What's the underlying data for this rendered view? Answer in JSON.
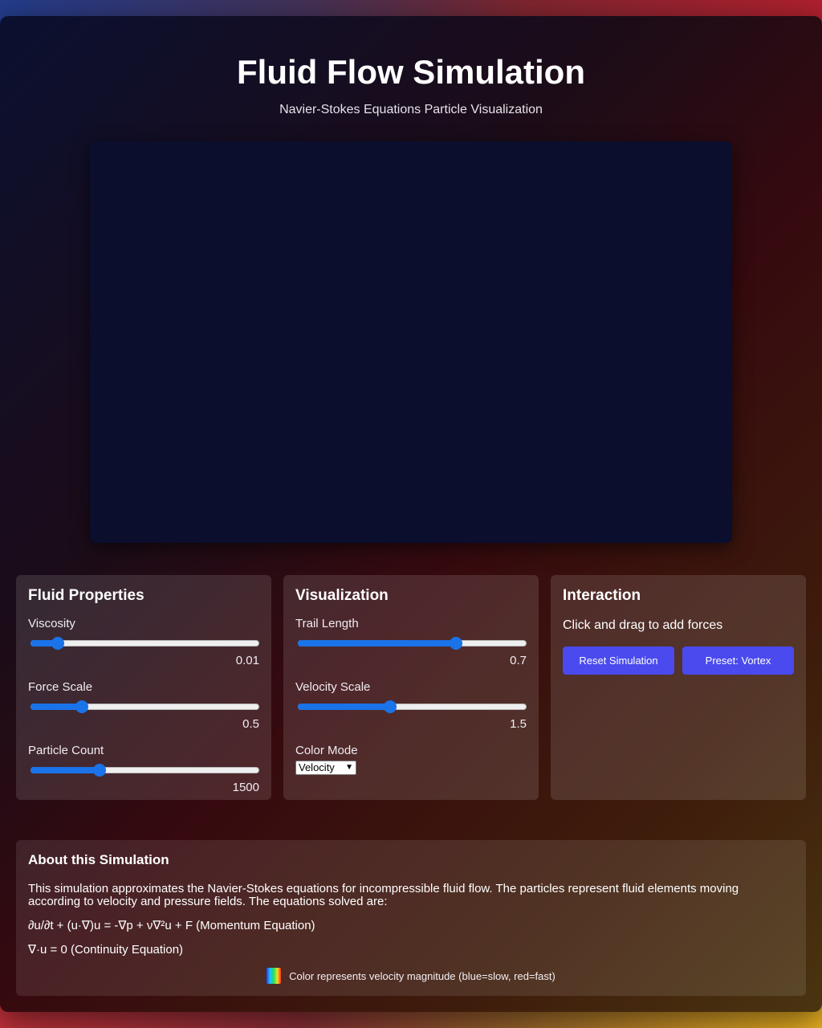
{
  "header": {
    "title": "Fluid Flow Simulation",
    "subtitle": "Navier-Stokes Equations Particle Visualization"
  },
  "fluid_properties": {
    "title": "Fluid Properties",
    "viscosity": {
      "label": "Viscosity",
      "value": "0.01",
      "fraction": 0.12
    },
    "force_scale": {
      "label": "Force Scale",
      "value": "0.5",
      "fraction": 0.225
    },
    "particle_count": {
      "label": "Particle Count",
      "value": "1500",
      "fraction": 0.3
    }
  },
  "visualization": {
    "title": "Visualization",
    "trail_length": {
      "label": "Trail Length",
      "value": "0.7",
      "fraction": 0.69
    },
    "velocity_scale": {
      "label": "Velocity Scale",
      "value": "1.5",
      "fraction": 0.405
    },
    "color_mode": {
      "label": "Color Mode",
      "selected": "Velocity"
    }
  },
  "interaction": {
    "title": "Interaction",
    "hint": "Click and drag to add forces",
    "reset_label": "Reset Simulation",
    "preset_label": "Preset: Vortex"
  },
  "about": {
    "title": "About this Simulation",
    "description": "This simulation approximates the Navier-Stokes equations for incompressible fluid flow. The particles represent fluid elements moving according to velocity and pressure fields. The equations solved are:",
    "equation_momentum": "∂u/∂t + (u·∇)u = -∇p + ν∇²u + F (Momentum Equation)",
    "equation_continuity": "∇·u = 0 (Continuity Equation)",
    "legend": "Color represents velocity magnitude (blue=slow, red=fast)"
  },
  "colors": {
    "accent": "#1a73e8",
    "button": "#4a4aef",
    "canvas": "#0b0e2c"
  }
}
